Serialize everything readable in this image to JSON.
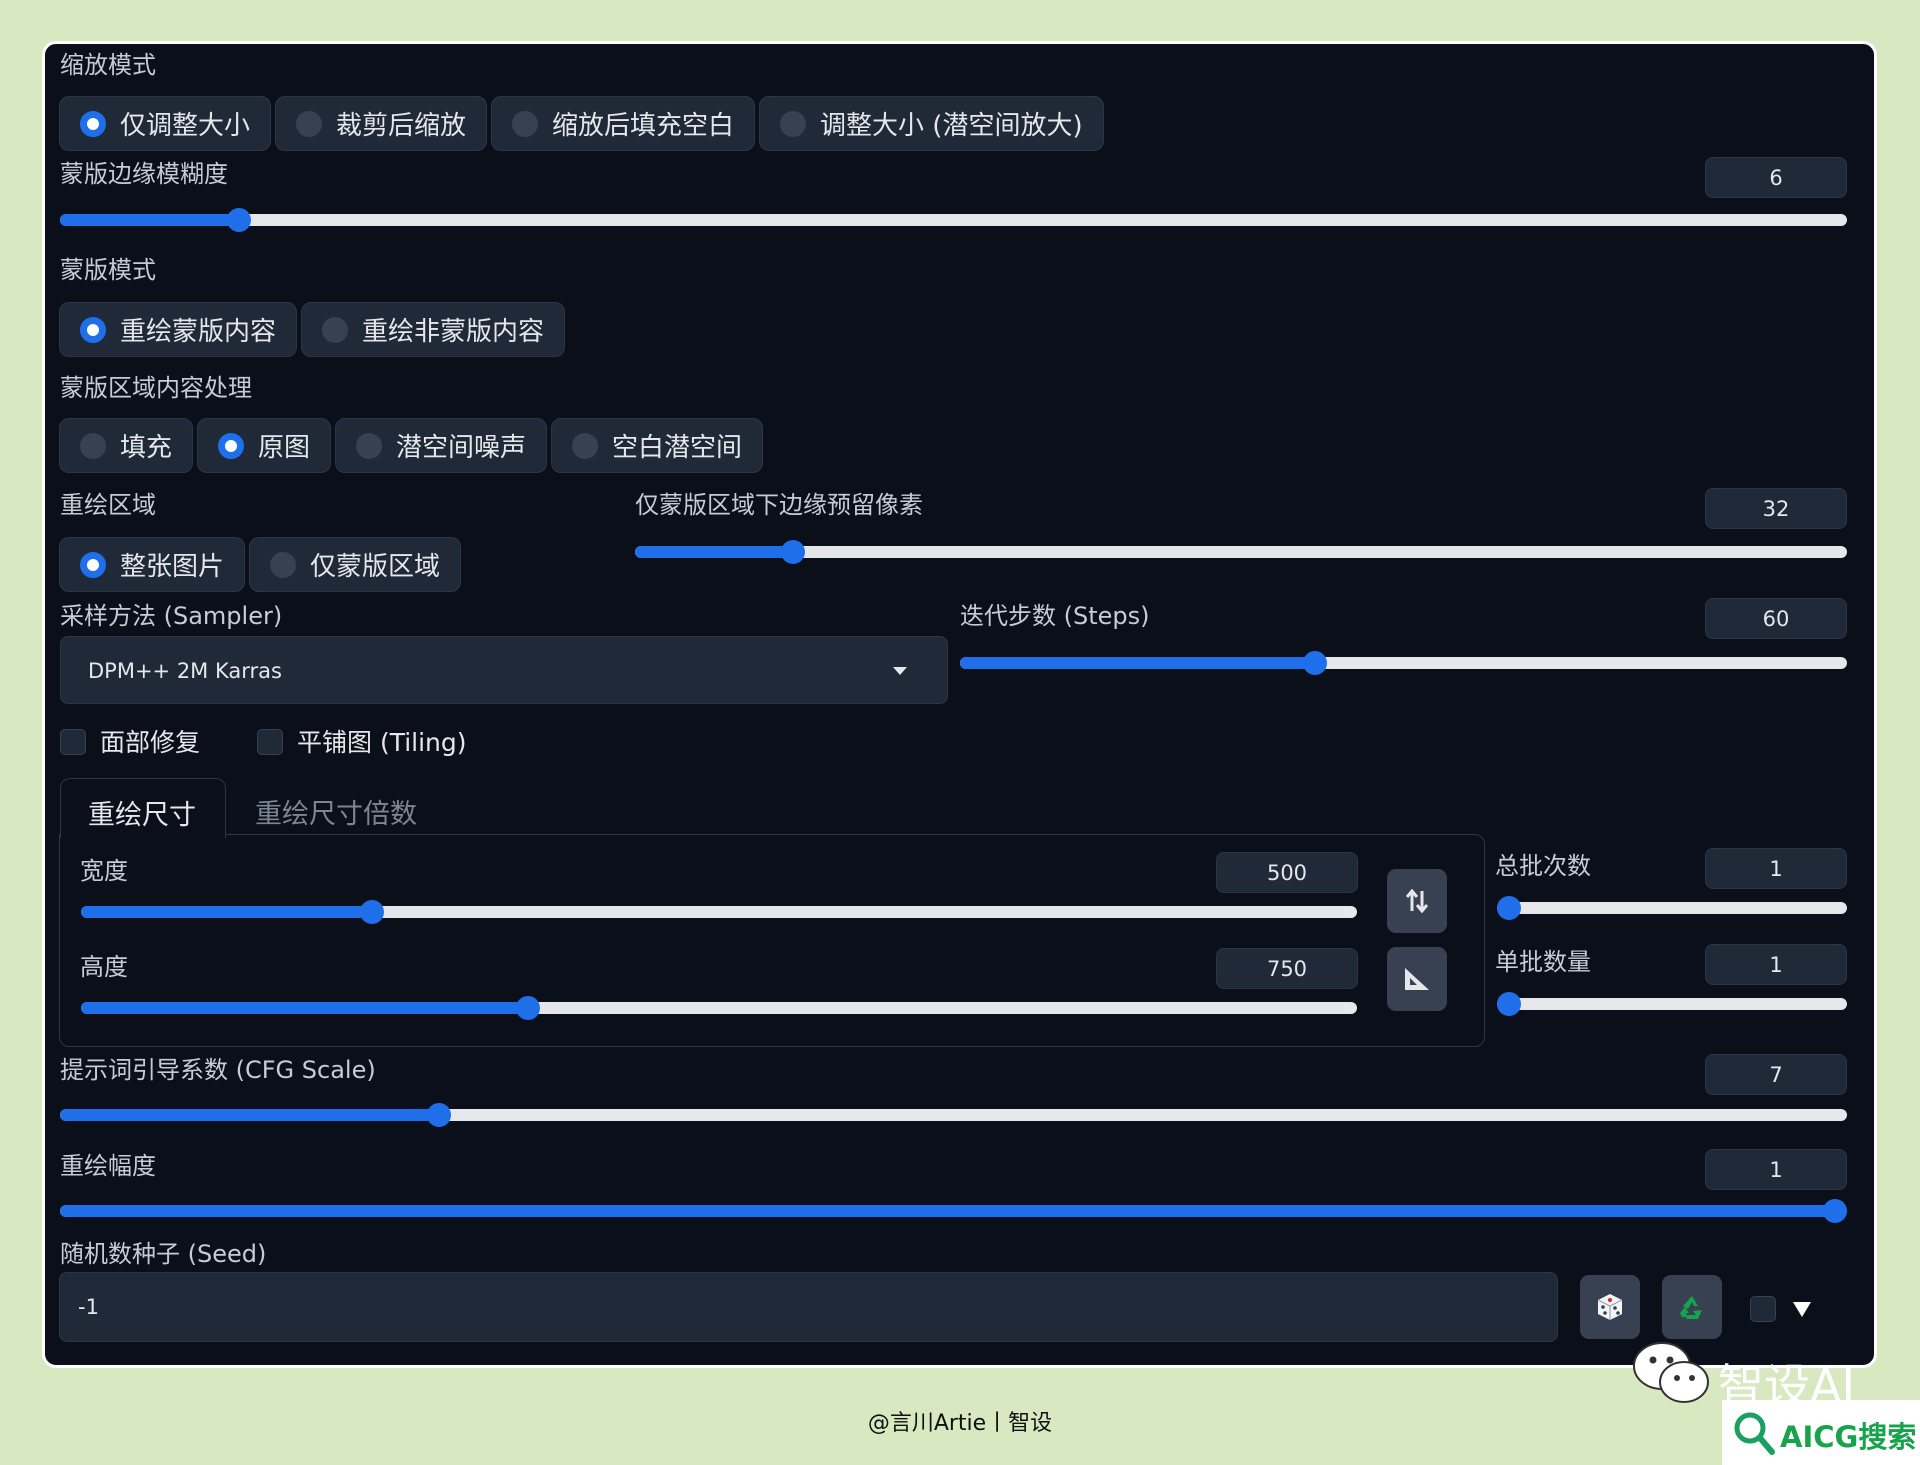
{
  "resize_mode": {
    "label": "缩放模式",
    "options": [
      "仅调整大小",
      "裁剪后缩放",
      "缩放后填充空白",
      "调整大小 (潜空间放大)"
    ],
    "selected": 0
  },
  "mask_blur": {
    "label": "蒙版边缘模糊度",
    "value": "6",
    "fraction": 0.1
  },
  "mask_mode": {
    "label": "蒙版模式",
    "options": [
      "重绘蒙版内容",
      "重绘非蒙版内容"
    ],
    "selected": 0
  },
  "masked_content": {
    "label": "蒙版区域内容处理",
    "options": [
      "填充",
      "原图",
      "潜空间噪声",
      "空白潜空间"
    ],
    "selected": 1
  },
  "inpaint_area": {
    "label": "重绘区域",
    "options": [
      "整张图片",
      "仅蒙版区域"
    ],
    "selected": 0
  },
  "only_masked_padding": {
    "label": "仅蒙版区域下边缘预留像素",
    "value": "32",
    "fraction": 0.13
  },
  "sampler": {
    "label": "采样方法 (Sampler)",
    "value": "DPM++ 2M Karras"
  },
  "steps": {
    "label": "迭代步数 (Steps)",
    "value": "60",
    "fraction": 0.4
  },
  "checkboxes": {
    "face_restore": "面部修复",
    "tiling": "平铺图 (Tiling)"
  },
  "tabs": [
    "重绘尺寸",
    "重绘尺寸倍数"
  ],
  "width": {
    "label": "宽度",
    "value": "500",
    "fraction": 0.228
  },
  "height": {
    "label": "高度",
    "value": "750",
    "fraction": 0.35
  },
  "batch_count": {
    "label": "总批次数",
    "value": "1",
    "fraction": 0.0
  },
  "batch_size": {
    "label": "单批数量",
    "value": "1",
    "fraction": 0.0
  },
  "cfg_scale": {
    "label": "提示词引导系数 (CFG Scale)",
    "value": "7",
    "fraction": 0.212
  },
  "denoising": {
    "label": "重绘幅度",
    "value": "1",
    "fraction": 1.0
  },
  "seed": {
    "label": "随机数种子 (Seed)",
    "value": "-1"
  },
  "footer": {
    "credit": "@言川Artie丨智设",
    "watermark1": "智设AI",
    "watermark2": "AICG搜索"
  },
  "colors": {
    "accent": "#1f6feb",
    "panel_bg": "#0b0f19",
    "control_bg": "#1f2937",
    "page_bg": "#d8e8c0"
  }
}
